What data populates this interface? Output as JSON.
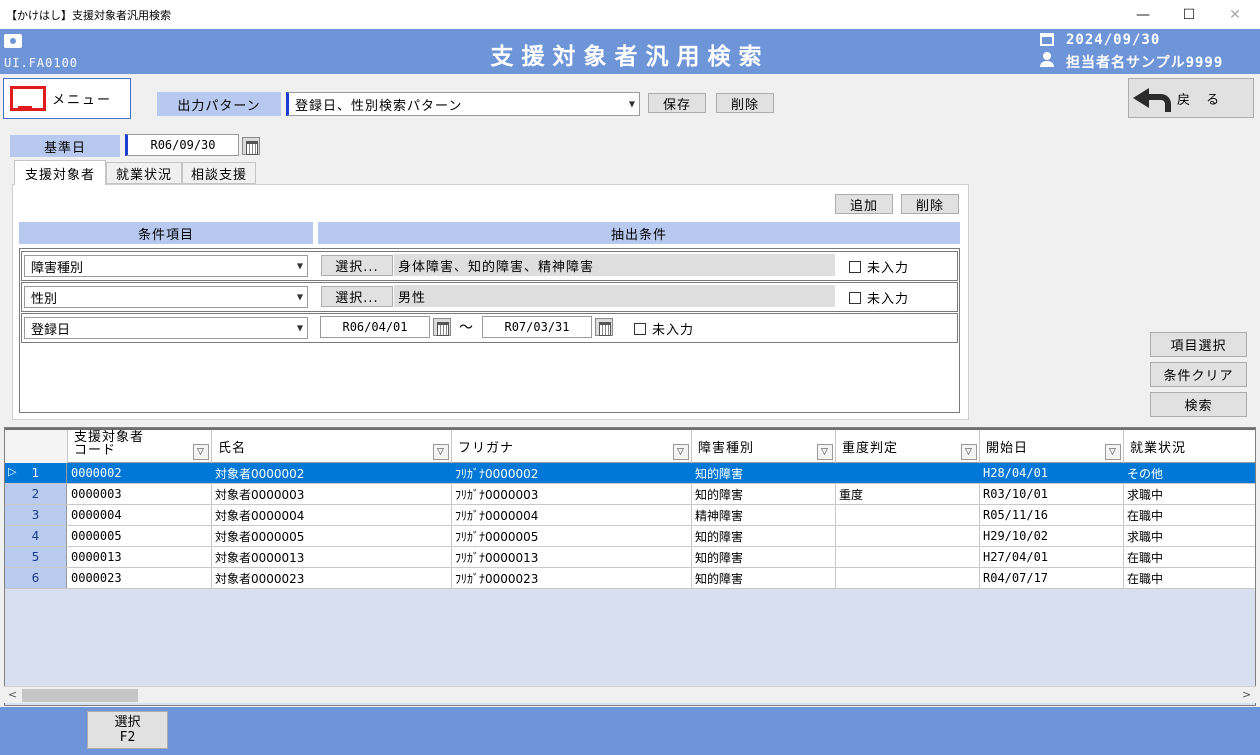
{
  "window": {
    "title": "【かけはし】支援対象者汎用検索",
    "minimize": "—",
    "maximize": "☐",
    "close": "✕"
  },
  "header": {
    "screen_id": "UI.FA0100",
    "page_title": "支援対象者汎用検索",
    "date": "2024/09/30",
    "user": "担当者名サンプル9999"
  },
  "menu_label": "メニュー",
  "back_label": "戻 る",
  "pattern": {
    "label": "出力パターン",
    "value": "登録日、性別検索パターン",
    "save": "保存",
    "delete": "削除"
  },
  "base_date": {
    "label": "基準日",
    "value": "R06/09/30"
  },
  "tabs": [
    "支援対象者",
    "就業状況",
    "相談支援"
  ],
  "conditions": {
    "add": "追加",
    "delete": "削除",
    "col_item": "条件項目",
    "col_extract": "抽出条件",
    "select_label": "選択...",
    "empty_label": "未入力",
    "tilde": "～",
    "rows": [
      {
        "item": "障害種別",
        "value": "身体障害、知的障害、精神障害"
      },
      {
        "item": "性別",
        "value": "男性"
      },
      {
        "item": "登録日",
        "from": "R06/04/01",
        "to": "R07/03/31"
      }
    ]
  },
  "side_buttons": {
    "item_select": "項目選択",
    "clear": "条件クリア",
    "search": "検索"
  },
  "grid": {
    "columns": [
      "支援対象者\nコード",
      "氏名",
      "フリガナ",
      "障害種別",
      "重度判定",
      "開始日",
      "就業状況"
    ],
    "rows": [
      {
        "no": "1",
        "code": "0000002",
        "name": "対象者0000002",
        "kana": "ﾌﾘｶﾞﾅ0000002",
        "type": "知的障害",
        "severe": "",
        "start": "H28/04/01",
        "status": "その他"
      },
      {
        "no": "2",
        "code": "0000003",
        "name": "対象者0000003",
        "kana": "ﾌﾘｶﾞﾅ0000003",
        "type": "知的障害",
        "severe": "重度",
        "start": "R03/10/01",
        "status": "求職中"
      },
      {
        "no": "3",
        "code": "0000004",
        "name": "対象者0000004",
        "kana": "ﾌﾘｶﾞﾅ0000004",
        "type": "精神障害",
        "severe": "",
        "start": "R05/11/16",
        "status": "在職中"
      },
      {
        "no": "4",
        "code": "0000005",
        "name": "対象者0000005",
        "kana": "ﾌﾘｶﾞﾅ0000005",
        "type": "知的障害",
        "severe": "",
        "start": "H29/10/02",
        "status": "求職中"
      },
      {
        "no": "5",
        "code": "0000013",
        "name": "対象者0000013",
        "kana": "ﾌﾘｶﾞﾅ0000013",
        "type": "知的障害",
        "severe": "",
        "start": "H27/04/01",
        "status": "在職中"
      },
      {
        "no": "6",
        "code": "0000023",
        "name": "対象者0000023",
        "kana": "ﾌﾘｶﾞﾅ0000023",
        "type": "知的障害",
        "severe": "",
        "start": "R04/07/17",
        "status": "在職中"
      }
    ]
  },
  "footer": {
    "select_label": "選択",
    "select_key": "F2"
  }
}
